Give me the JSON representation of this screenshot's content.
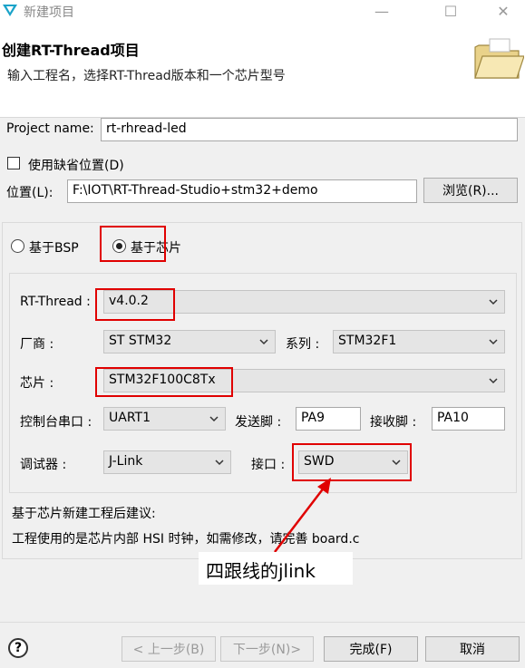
{
  "window": {
    "title": "新建项目",
    "minimize": "—",
    "maximize": "☐",
    "close": "✕"
  },
  "header": {
    "title": "创建RT-Thread项目",
    "subtitle": "输入工程名，选择RT-Thread版本和一个芯片型号"
  },
  "project": {
    "name_label": "Project name:",
    "name_value": "rt-rhread-led",
    "default_location_label": "使用缺省位置(D)",
    "default_location_checked": false,
    "location_label": "位置(L):",
    "location_value": "F:\\IOT\\RT-Thread-Studio+stm32+demo",
    "browse_label": "浏览(R)..."
  },
  "mode": {
    "bsp_label": "基于BSP",
    "chip_label": "基于芯片",
    "selected": "chip"
  },
  "config": {
    "rtthread_label": "RT-Thread :",
    "rtthread_value": "v4.0.2",
    "vendor_label": "厂商 :",
    "vendor_value": "ST STM32",
    "series_label": "系列 :",
    "series_value": "STM32F1",
    "chip_label": "芯片 :",
    "chip_value": "STM32F100C8Tx",
    "console_label": "控制台串口 :",
    "console_value": "UART1",
    "tx_label": "发送脚 :",
    "tx_value": "PA9",
    "rx_label": "接收脚 :",
    "rx_value": "PA10",
    "debugger_label": "调试器 :",
    "debugger_value": "J-Link",
    "interface_label": "接口 :",
    "interface_value": "SWD"
  },
  "advice": {
    "title": "基于芯片新建工程后建议:",
    "text": "工程使用的是芯片内部 HSI 时钟，如需修改，请完善 board.c"
  },
  "annotation": {
    "text": "四跟线的jlink",
    "color": "#e00000"
  },
  "footer": {
    "help": "?",
    "back_label": "< 上一步(B)",
    "next_label": "下一步(N)>",
    "finish_label": "完成(F)",
    "cancel_label": "取消"
  }
}
